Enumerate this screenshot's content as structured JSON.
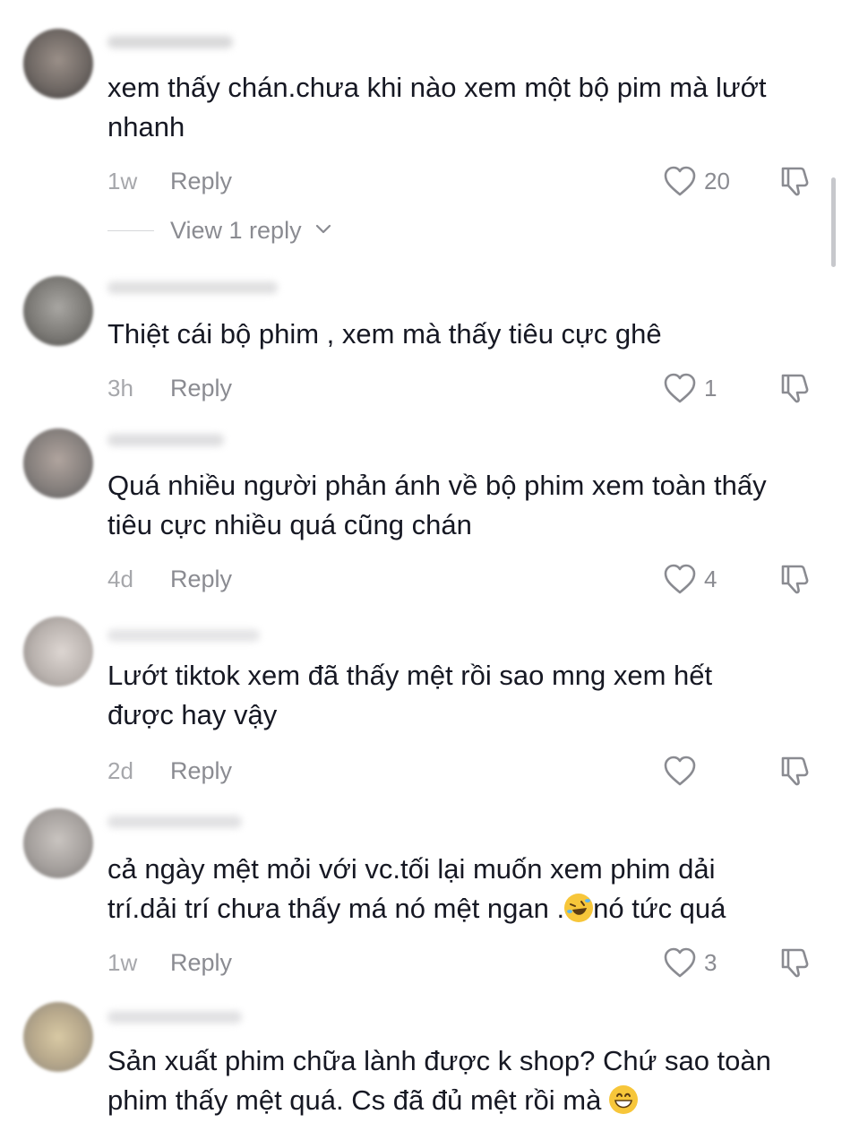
{
  "colors": {
    "text": "#161823",
    "secondary": "#8a8b91",
    "time": "#a6a7ab",
    "icon": "#8a8b91",
    "emoji": "#f7c63a"
  },
  "labels": {
    "reply": "Reply",
    "view_replies": "View 1 reply"
  },
  "comments": [
    {
      "text": "xem thấy chán.chưa khi nào xem một bộ pim mà lướt\nnhanh",
      "time": "1w",
      "likes": "20"
    },
    {
      "text": "Thiệt cái bộ phim , xem mà thấy tiêu cực ghê",
      "time": "3h",
      "likes": "1"
    },
    {
      "text": "Quá nhiều người phản ánh về bộ phim xem toàn thấy\ntiêu cực nhiều quá cũng chán",
      "time": "4d",
      "likes": "4"
    },
    {
      "text": "Lướt tiktok xem đã thấy mệt rồi sao mng xem hết\nđược hay vậy",
      "time": "2d",
      "likes": ""
    },
    {
      "text_before_emoji": "cả ngày mệt mỏi với vc.tối lại muốn xem phim dải\ntrí.dải trí chưa thấy má nó mệt ngan .",
      "emoji": "rolling-on-floor-laughing-emoji",
      "text_after_emoji": "nó tức quá",
      "time": "1w",
      "likes": "3"
    },
    {
      "text": "Sản xuất phim chữa lành được k shop? Chứ sao toàn\nphim thấy mệt quá. Cs đã đủ mệt rồi mà ",
      "emoji": "grinning-face-emoji"
    }
  ]
}
